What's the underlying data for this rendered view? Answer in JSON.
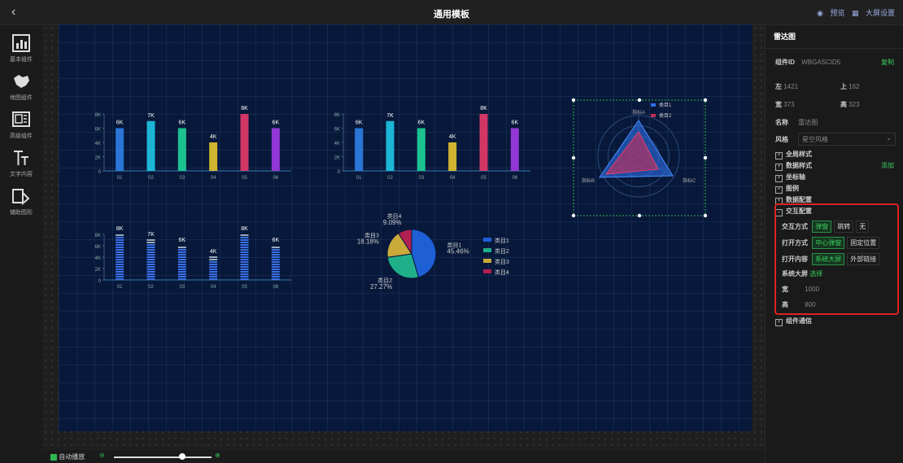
{
  "topbar": {
    "title": "通用模板",
    "preview": "预览",
    "screen_settings": "大屏设置"
  },
  "left_tools": [
    {
      "label": "基本组件",
      "icon": "bar-chart-icon"
    },
    {
      "label": "地图组件",
      "icon": "map-icon"
    },
    {
      "label": "高级组件",
      "icon": "layout-icon"
    },
    {
      "label": "文字内容",
      "icon": "text-icon"
    },
    {
      "label": "辅助图形",
      "icon": "shapes-icon"
    }
  ],
  "bottombar": {
    "auto_zoom": "自动播放"
  },
  "panel": {
    "header": "雷达图",
    "component_id_label": "组件ID",
    "component_id": "WBGASCID5",
    "copy": "复制",
    "left_label": "左",
    "left_value": "1421",
    "top_label": "上",
    "top_value": "162",
    "width_label": "宽",
    "width_value": "373",
    "height_label": "高",
    "height_value": "323",
    "name_label": "名称",
    "name_value": "雷达图",
    "style_label": "风格",
    "style_value": "星空风格",
    "sections": [
      "全局样式",
      "数据样式",
      "坐标轴",
      "图例",
      "数据配置"
    ],
    "add": "添加",
    "interaction": {
      "title": "交互配置",
      "mode_label": "交互方式",
      "mode_options": [
        "弹窗",
        "跳转",
        "无"
      ],
      "open_label": "打开方式",
      "open_options": [
        "中心弹窗",
        "固定位置"
      ],
      "content_label": "打开内容",
      "content_options": [
        "系统大屏",
        "外部链接"
      ],
      "system_label": "系统大屏",
      "system_value": "选择",
      "w_label": "宽",
      "w_value": "1000",
      "h_label": "高",
      "h_value": "800"
    },
    "comm": "组件通信"
  },
  "chart_data": [
    {
      "type": "bar",
      "categories": [
        "01",
        "02",
        "03",
        "04",
        "05",
        "06"
      ],
      "values": [
        6,
        7,
        6,
        4,
        8,
        6
      ],
      "labels": [
        "6K",
        "7K",
        "6K",
        "4K",
        "8K",
        "6K"
      ],
      "yticks": [
        "0",
        "2K",
        "4K",
        "6K",
        "8K"
      ],
      "ylim": [
        0,
        8
      ],
      "colors": [
        "#2f7fe8",
        "#1fc6e8",
        "#1fd49a",
        "#e8c52f",
        "#e83a6a",
        "#a33ae8"
      ]
    },
    {
      "type": "bar",
      "categories": [
        "01",
        "02",
        "03",
        "04",
        "05",
        "06"
      ],
      "values": [
        6,
        7,
        6,
        4,
        8,
        6
      ],
      "labels": [
        "6K",
        "7K",
        "6K",
        "4K",
        "8K",
        "6K"
      ],
      "yticks": [
        "0",
        "2K",
        "4K",
        "6K",
        "8K"
      ],
      "ylim": [
        0,
        8
      ],
      "colors": [
        "#2f7fe8",
        "#1fc6e8",
        "#1fd49a",
        "#e8c52f",
        "#e83a6a",
        "#a33ae8"
      ]
    },
    {
      "type": "bar",
      "categories": [
        "01",
        "02",
        "03",
        "04",
        "05",
        "06"
      ],
      "values": [
        8,
        7,
        6,
        4,
        8,
        6
      ],
      "labels": [
        "8K",
        "7K",
        "6K",
        "4K",
        "8K",
        "6K"
      ],
      "yticks": [
        "0",
        "2K",
        "4K",
        "6K",
        "8K"
      ],
      "ylim": [
        0,
        8
      ]
    },
    {
      "type": "pie",
      "slices": [
        {
          "name": "类目1",
          "value": 45.46,
          "label": "45.46%",
          "color": "#1f5fd6"
        },
        {
          "name": "类目2",
          "value": 27.27,
          "label": "27.27%",
          "color": "#1fb08a"
        },
        {
          "name": "类目3",
          "value": 18.18,
          "label": "18.18%",
          "color": "#c8a93a"
        },
        {
          "name": "类目4",
          "value": 9.09,
          "label": "9.09%",
          "color": "#b02050"
        }
      ]
    },
    {
      "type": "radar",
      "indicators": [
        "指标A",
        "指标B",
        "指标C"
      ],
      "series": [
        {
          "name": "类目1",
          "color": "#2f6fe8"
        },
        {
          "name": "类目2",
          "color": "#c0305a"
        }
      ]
    }
  ]
}
